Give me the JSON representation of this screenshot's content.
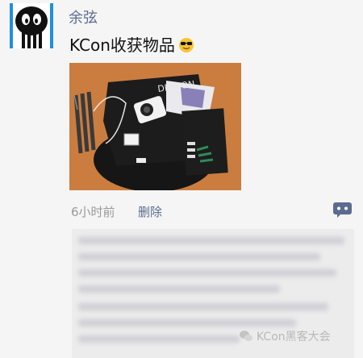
{
  "post": {
    "author": "余弦",
    "text": "KCon收获物品",
    "emoji": "cool-face-emoji",
    "time": "6小时前",
    "delete_label": "删除"
  },
  "watermark": {
    "text": "KCon黑客大会"
  },
  "colors": {
    "author_name": "#5c6b8f",
    "avatar_bg": "#1d8fe0",
    "time": "#9a9a9a"
  }
}
